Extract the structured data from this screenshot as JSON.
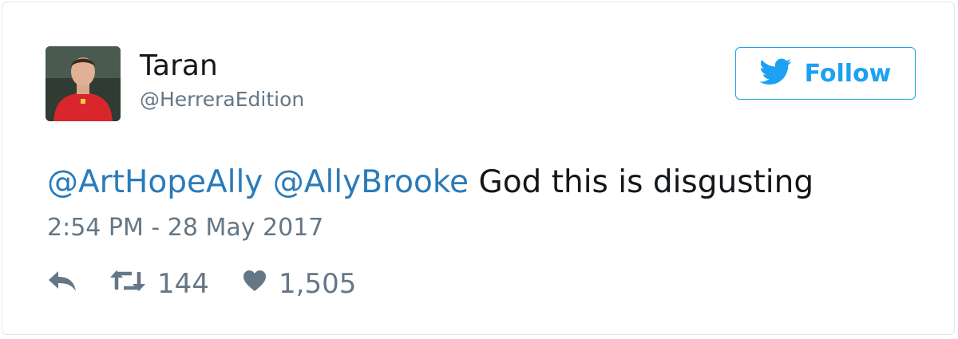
{
  "author": {
    "name": "Taran",
    "handle": "@HerreraEdition"
  },
  "follow_button": {
    "label": "Follow",
    "icon": "twitter-bird-icon",
    "color": "#1da1f2"
  },
  "tweet": {
    "mentions": [
      "@ArtHopeAlly",
      "@AllyBrooke"
    ],
    "text": "God this is disgusting",
    "timestamp": "2:54 PM - 28 May 2017"
  },
  "actions": {
    "reply_icon": "reply-icon",
    "retweet_icon": "retweet-icon",
    "retweet_count": "144",
    "like_icon": "heart-icon",
    "like_count": "1,505"
  },
  "colors": {
    "mention": "#2b7bb9",
    "secondary_text": "#657786",
    "primary_text": "#14171a"
  }
}
